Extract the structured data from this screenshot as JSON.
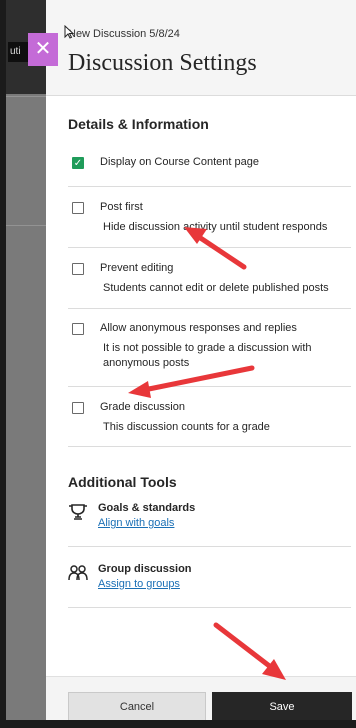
{
  "background": {
    "tab_label": "uti"
  },
  "panel": {
    "breadcrumb": "New Discussion 5/8/24",
    "title": "Discussion Settings",
    "close_icon": "close-icon"
  },
  "details": {
    "title": "Details & Information",
    "options": [
      {
        "label": "Display on Course Content page",
        "description": "",
        "checked": true
      },
      {
        "label": "Post first",
        "description": "Hide discussion activity until student responds",
        "checked": false
      },
      {
        "label": "Prevent editing",
        "description": "Students cannot edit or delete published posts",
        "checked": false
      },
      {
        "label": "Allow anonymous responses and replies",
        "description": "It is not possible to grade a discussion with anonymous posts",
        "checked": false
      },
      {
        "label": "Grade discussion",
        "description": "This discussion counts for a grade",
        "checked": false
      }
    ]
  },
  "tools": {
    "title": "Additional Tools",
    "items": [
      {
        "title": "Goals & standards",
        "link": "Align with goals",
        "icon": "trophy-icon"
      },
      {
        "title": "Group discussion",
        "link": "Assign to groups",
        "icon": "group-icon"
      }
    ]
  },
  "footer": {
    "cancel_label": "Cancel",
    "save_label": "Save"
  },
  "colors": {
    "accent_close": "#c46bd7",
    "checkbox_checked": "#1f9c5a",
    "link": "#1a6fb5",
    "annotation_arrow": "#e8373a",
    "save_button": "#262626"
  }
}
